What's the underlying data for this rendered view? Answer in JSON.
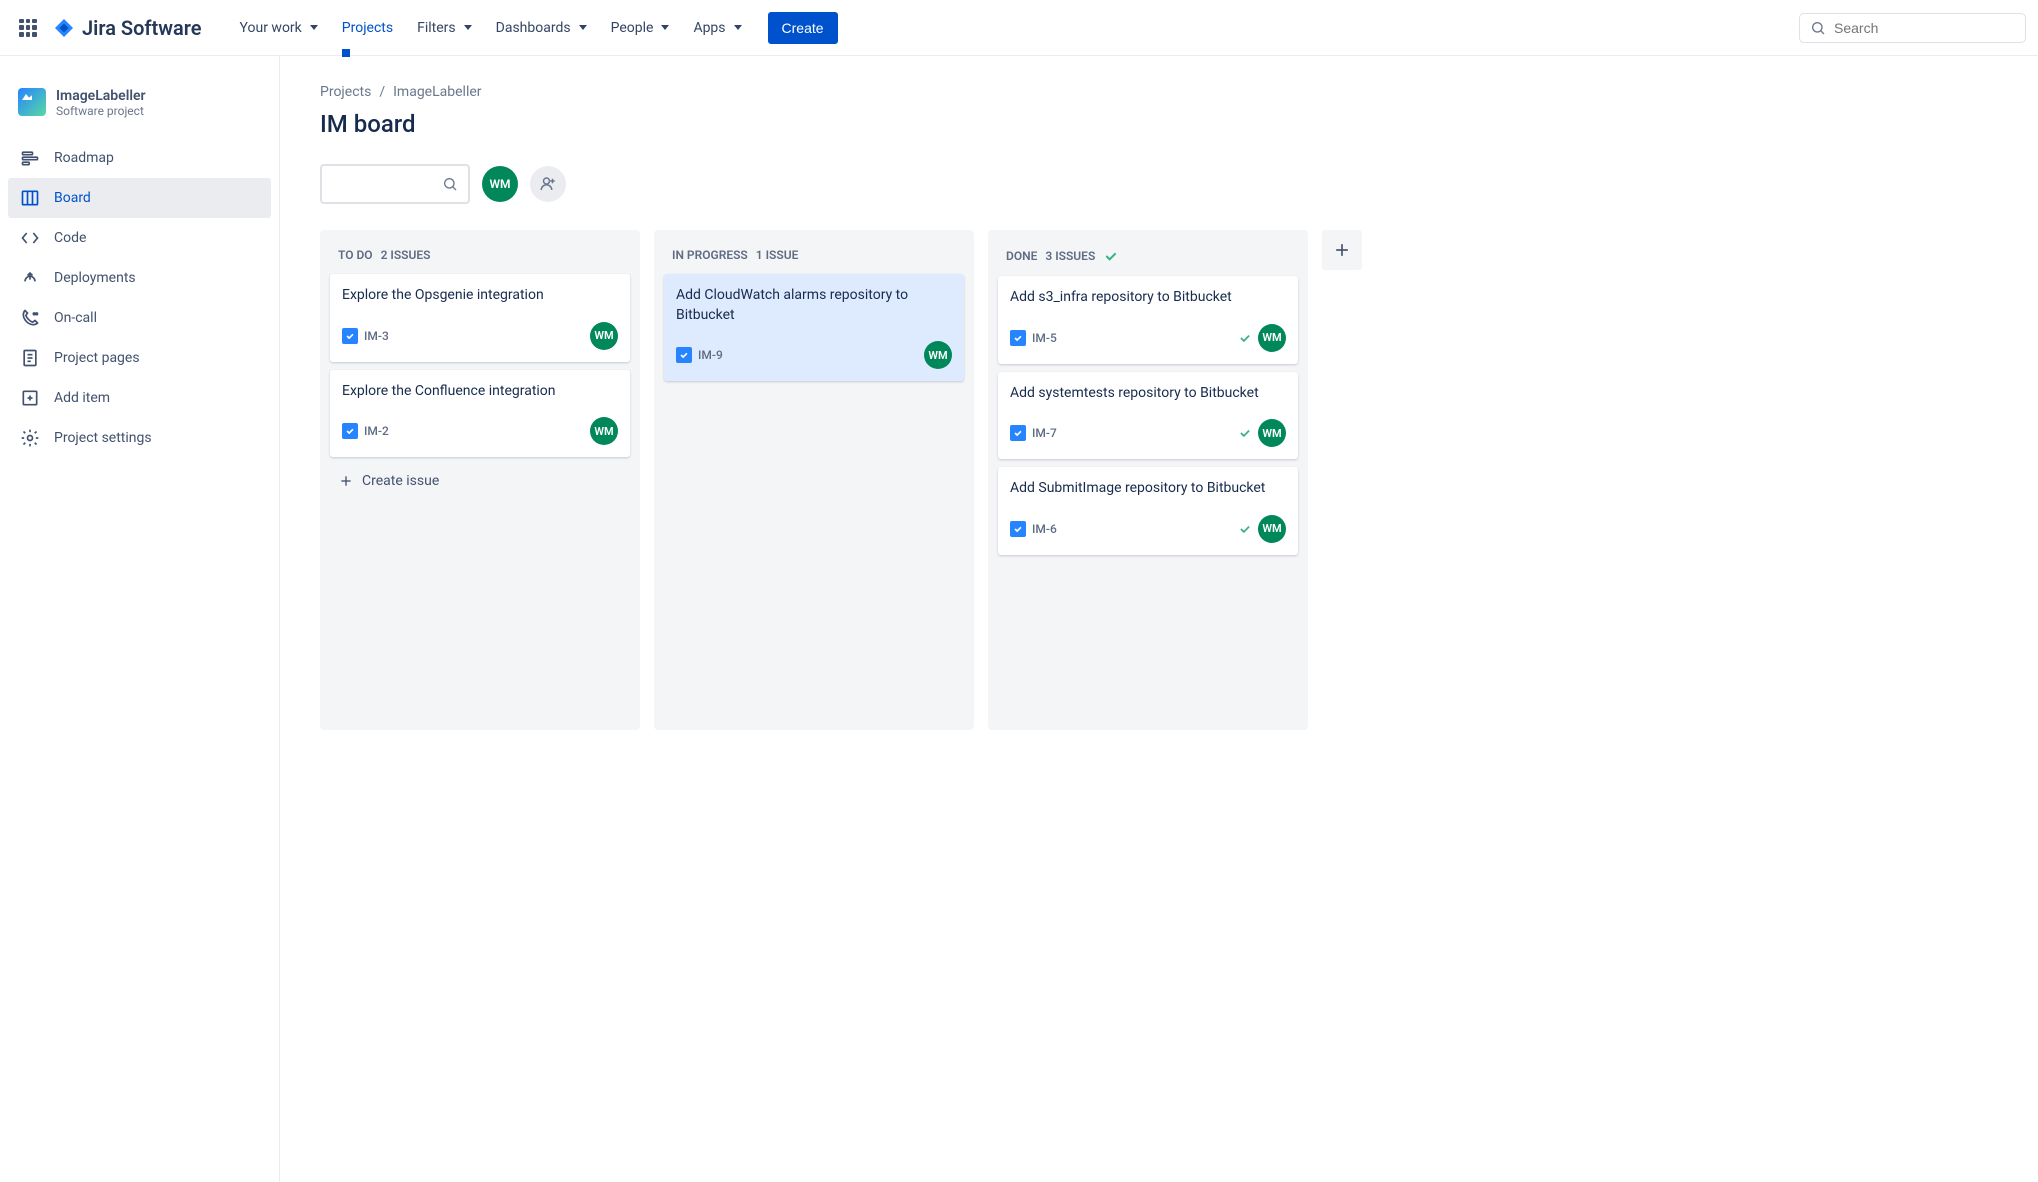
{
  "topbar": {
    "logo_text": "Jira Software",
    "nav": [
      {
        "label": "Your work",
        "active": false
      },
      {
        "label": "Projects",
        "active": true
      },
      {
        "label": "Filters",
        "active": false
      },
      {
        "label": "Dashboards",
        "active": false
      },
      {
        "label": "People",
        "active": false
      },
      {
        "label": "Apps",
        "active": false
      }
    ],
    "create_label": "Create",
    "search_placeholder": "Search"
  },
  "sidebar": {
    "project_name": "ImageLabeller",
    "project_type": "Software project",
    "items": [
      {
        "label": "Roadmap",
        "icon": "roadmap"
      },
      {
        "label": "Board",
        "icon": "board"
      },
      {
        "label": "Code",
        "icon": "code"
      },
      {
        "label": "Deployments",
        "icon": "deployments"
      },
      {
        "label": "On-call",
        "icon": "oncall"
      },
      {
        "label": "Project pages",
        "icon": "pages"
      },
      {
        "label": "Add item",
        "icon": "additem"
      },
      {
        "label": "Project settings",
        "icon": "settings"
      }
    ]
  },
  "breadcrumb": {
    "root": "Projects",
    "project": "ImageLabeller"
  },
  "page_title": "IM board",
  "user_initials": "WM",
  "columns": [
    {
      "name": "To Do",
      "count_label": "2 issues",
      "done": false,
      "cards": [
        {
          "title": "Explore the Opsgenie integration",
          "key": "IM-3",
          "assignee": "WM",
          "done": false
        },
        {
          "title": "Explore the Confluence integration",
          "key": "IM-2",
          "assignee": "WM",
          "done": false
        }
      ],
      "create_label": "Create issue"
    },
    {
      "name": "In Progress",
      "count_label": "1 issue",
      "done": false,
      "cards": [
        {
          "title": "Add CloudWatch alarms repository to Bitbucket",
          "key": "IM-9",
          "assignee": "WM",
          "done": false,
          "highlight": true
        }
      ]
    },
    {
      "name": "Done",
      "count_label": "3 issues",
      "done": true,
      "cards": [
        {
          "title": "Add s3_infra repository to Bitbucket",
          "key": "IM-5",
          "assignee": "WM",
          "done": true
        },
        {
          "title": "Add systemtests repository to Bitbucket",
          "key": "IM-7",
          "assignee": "WM",
          "done": true
        },
        {
          "title": "Add SubmitImage repository to Bitbucket",
          "key": "IM-6",
          "assignee": "WM",
          "done": true
        }
      ]
    }
  ]
}
